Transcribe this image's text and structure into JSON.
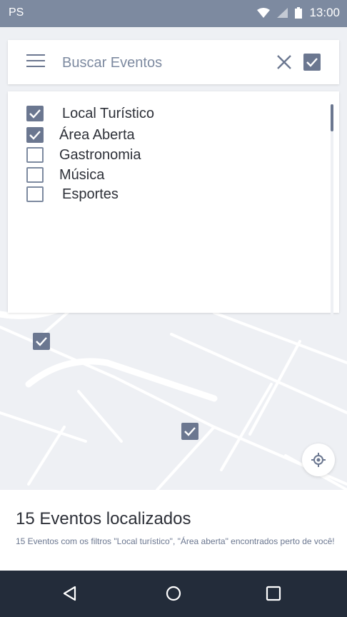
{
  "status_bar": {
    "carrier": "PS",
    "time": "13:00"
  },
  "search": {
    "placeholder": "Buscar Eventos",
    "value": ""
  },
  "filters": [
    {
      "label": "Local Turístico",
      "checked": true
    },
    {
      "label": "Área Aberta",
      "checked": true
    },
    {
      "label": "Gastronomia",
      "checked": false
    },
    {
      "label": "Música",
      "checked": false
    },
    {
      "label": "Esportes",
      "checked": false
    }
  ],
  "results": {
    "title": "15 Eventos localizados",
    "description": "15 Eventos com os filtros \"Local turístico\", \"Área aberta\" encontrados perto de você!"
  },
  "icons": {
    "menu": "hamburger-menu-icon",
    "clear": "close-icon",
    "confirm": "check-icon",
    "locate": "my-location-icon",
    "back": "back-triangle-icon",
    "home": "home-circle-icon",
    "recents": "recents-square-icon"
  },
  "colors": {
    "accent": "#6b7790",
    "status_bar": "#7d8aa0",
    "nav_bar": "#232c3a",
    "map_bg": "#eef0f4"
  }
}
